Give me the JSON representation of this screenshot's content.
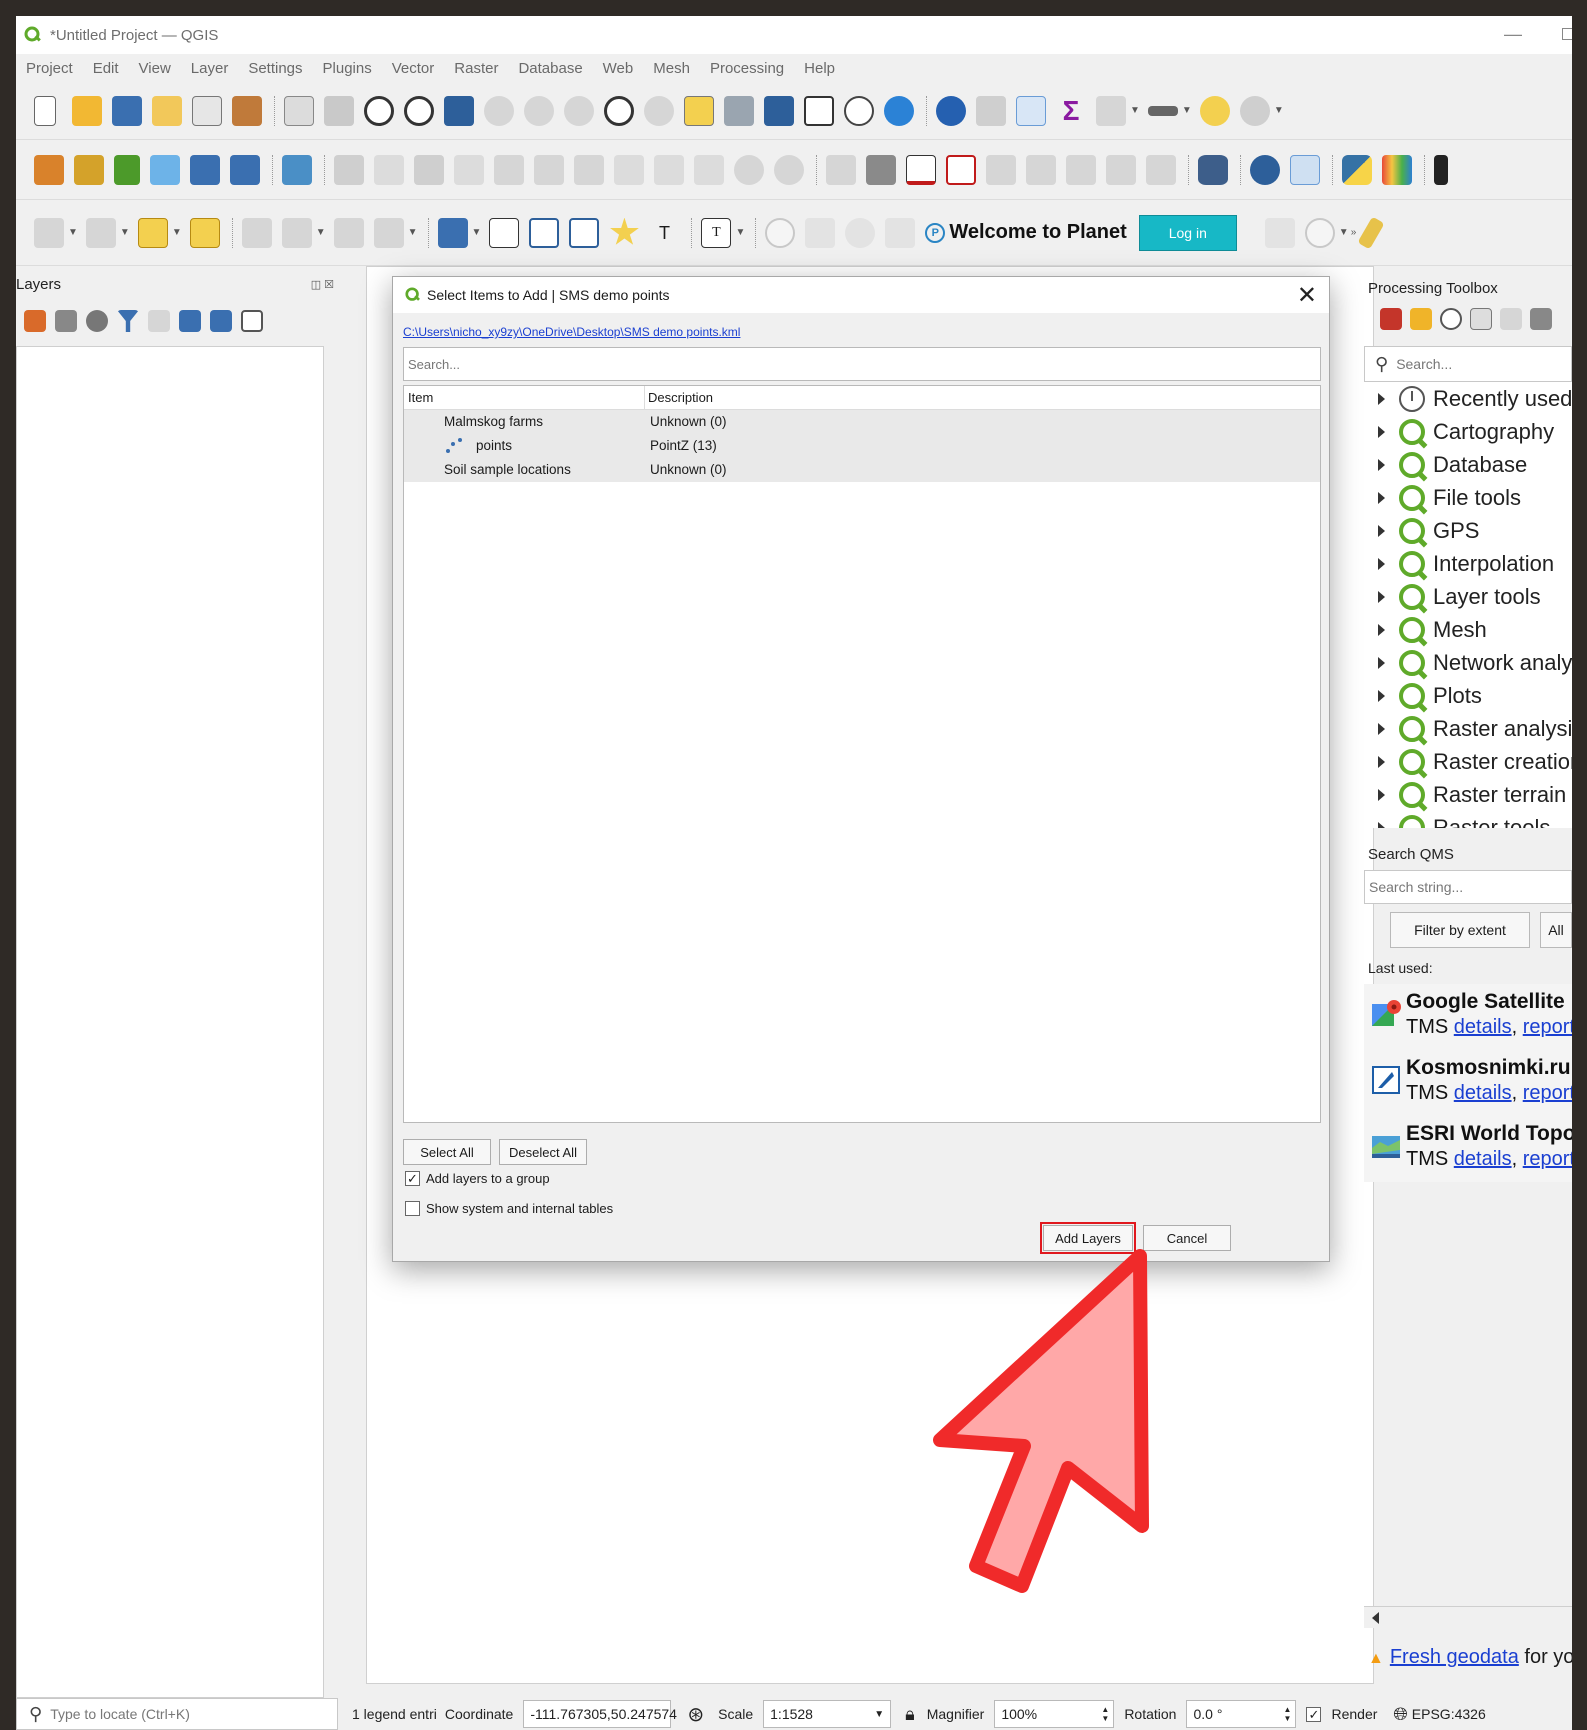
{
  "window": {
    "title": "*Untitled Project — QGIS"
  },
  "menu": [
    "Project",
    "Edit",
    "View",
    "Layer",
    "Settings",
    "Plugins",
    "Vector",
    "Raster",
    "Database",
    "Web",
    "Mesh",
    "Processing",
    "Help"
  ],
  "planet": {
    "welcome": "Welcome to Planet",
    "login": "Log in"
  },
  "layers_panel": {
    "title": "Layers"
  },
  "processing": {
    "title": "Processing Toolbox",
    "search_placeholder": "Search...",
    "items": [
      "Recently used",
      "Cartography",
      "Database",
      "File tools",
      "GPS",
      "Interpolation",
      "Layer tools",
      "Mesh",
      "Network analysis",
      "Plots",
      "Raster analysis",
      "Raster creation",
      "Raster terrain",
      "Raster tools"
    ]
  },
  "qms": {
    "title": "Search QMS",
    "placeholder": "Search string...",
    "filter_btn": "Filter by extent",
    "all_btn": "All",
    "last_used": "Last used:",
    "services": [
      {
        "name": "Google Satellite",
        "type": "TMS",
        "details": "details",
        "report": "report"
      },
      {
        "name": "Kosmosnimki.ru",
        "type": "TMS",
        "details": "details",
        "report": "report"
      },
      {
        "name": "ESRI World Topo",
        "type": "TMS",
        "details": "details",
        "report": "report"
      }
    ],
    "fresh_link": "Fresh geodata",
    "fresh_rest": "for you"
  },
  "dialog": {
    "title": "Select Items to Add | SMS demo points",
    "path": "C:\\Users\\nicho_xy9zy\\OneDrive\\Desktop\\SMS demo points.kml",
    "search_placeholder": "Search...",
    "col_item": "Item",
    "col_desc": "Description",
    "rows": [
      {
        "item": "Malmskog farms",
        "desc": "Unknown (0)"
      },
      {
        "item": "points",
        "desc": "PointZ (13)"
      },
      {
        "item": "Soil sample locations",
        "desc": "Unknown (0)"
      }
    ],
    "select_all": "Select All",
    "deselect_all": "Deselect All",
    "chk_group": "Add layers to a group",
    "chk_group_checked": true,
    "chk_system": "Show system and internal tables",
    "chk_system_checked": false,
    "add_layers": "Add Layers",
    "cancel": "Cancel"
  },
  "status": {
    "locate_placeholder": "Type to locate (Ctrl+K)",
    "legend": "1 legend entri",
    "coord_label": "Coordinate",
    "coord_value": "-111.767305,50.247574",
    "scale_label": "Scale",
    "scale_value": "1:1528",
    "magnifier_label": "Magnifier",
    "magnifier_value": "100%",
    "rotation_label": "Rotation",
    "rotation_value": "0.0 °",
    "render_label": "Render",
    "crs": "EPSG:4326"
  },
  "colors": {
    "highlight": "#e0181e",
    "qgis_green": "#5faa2a",
    "link": "#1a3fd1",
    "login_bg": "#17b8c6"
  }
}
